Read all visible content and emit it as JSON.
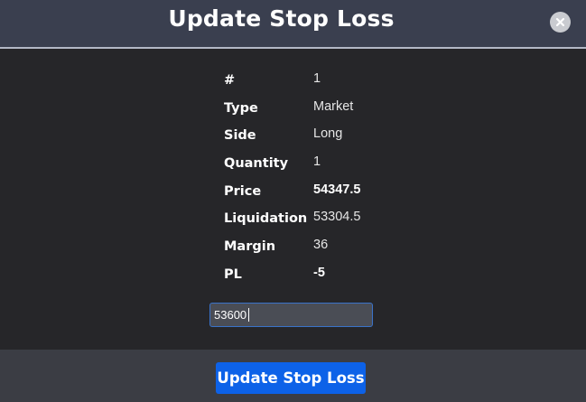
{
  "dialog": {
    "title": "Update Stop Loss",
    "close_icon": "close-icon"
  },
  "details": [
    {
      "label": "#",
      "value": "1",
      "emphasis": false
    },
    {
      "label": "Type",
      "value": "Market",
      "emphasis": false
    },
    {
      "label": "Side",
      "value": "Long",
      "emphasis": false
    },
    {
      "label": "Quantity",
      "value": "1",
      "emphasis": false
    },
    {
      "label": "Price",
      "value": "54347.5",
      "emphasis": true
    },
    {
      "label": "Liquidation",
      "value": "53304.5",
      "emphasis": false
    },
    {
      "label": "Margin",
      "value": "36",
      "emphasis": false
    },
    {
      "label": "PL",
      "value": "-5",
      "emphasis": true
    }
  ],
  "stop_loss_input": {
    "value": "53600"
  },
  "footer": {
    "submit_label": "Update Stop Loss"
  },
  "colors": {
    "header_bg": "#3a3f4f",
    "body_bg": "#262629",
    "footer_bg": "#3b3d44",
    "accent": "#0d62e8"
  }
}
